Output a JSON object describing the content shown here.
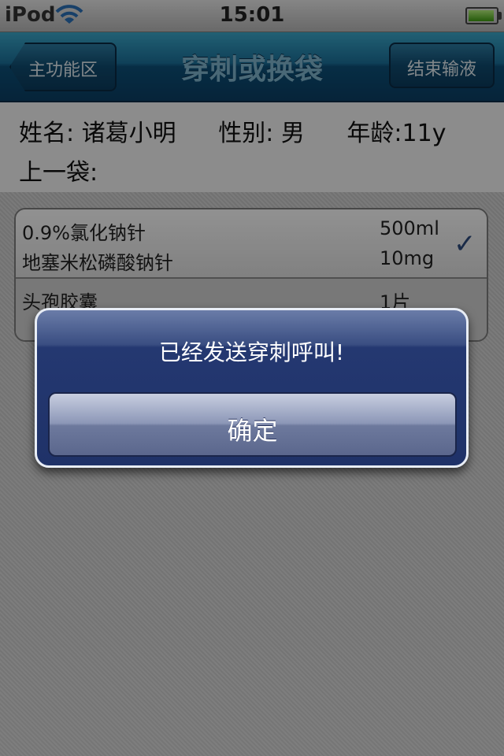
{
  "status_bar": {
    "carrier": "iPod",
    "time": "15:01"
  },
  "nav": {
    "back_label": "主功能区",
    "title": "穿刺或换袋",
    "end_label": "结束输液"
  },
  "patient": {
    "name_label": "姓名:",
    "name": "诸葛小明",
    "sex_label": "性别:",
    "sex": "男",
    "age_label": "年龄:",
    "age": "11y",
    "prev_bag_label": "上一袋:"
  },
  "infusion_groups": [
    {
      "checked": true,
      "items": [
        {
          "drug": "0.9%氯化钠针",
          "dose": "500ml"
        },
        {
          "drug": "地塞米松磷酸钠针",
          "dose": "10mg"
        }
      ]
    },
    {
      "checked": false,
      "items": [
        {
          "drug": "头孢胶囊",
          "dose": "1片"
        }
      ]
    }
  ],
  "alert": {
    "message": "已经发送穿刺呼叫!",
    "ok_label": "确定"
  }
}
